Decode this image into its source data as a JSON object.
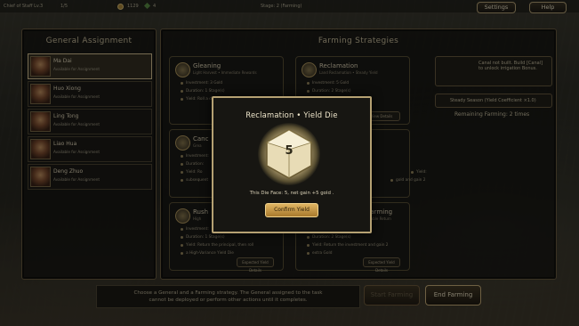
{
  "topbar": {
    "player_label": "Chief of Staff Lv.3",
    "player_extra": "1/5",
    "gold": "1129",
    "gems": "4",
    "stage": "Stage: 2 (Farming)",
    "settings_label": "Settings",
    "help_label": "Help"
  },
  "generals_panel": {
    "title": "General Assignment",
    "items": [
      {
        "name": "Ma Dai",
        "status": "Available for Assignment"
      },
      {
        "name": "Huo Xiong",
        "status": "Available for Assignment"
      },
      {
        "name": "Ling Tong",
        "status": "Available for Assignment"
      },
      {
        "name": "Liao Hua",
        "status": "Available for Assignment"
      },
      {
        "name": "Deng Zhuo",
        "status": "Available for Assignment"
      }
    ]
  },
  "strategies_panel": {
    "title": "Farming Strategies",
    "cards": [
      {
        "title": "Gleaning",
        "subtitle": "Light Harvest • Immediate Rewards",
        "lines": [
          "Investment: 3 Gold",
          "Duration: 1 Stage(s)",
          "Yield: Roll a d4 Yield Die"
        ],
        "button": "View Details"
      },
      {
        "title": "Reclamation",
        "subtitle": "Land Reclamation • Steady Yield",
        "lines": [
          "Investment: 5 Gold",
          "Duration: 2 Stage(s)",
          "Yield: Roll a High-Yield Die"
        ],
        "button": "View Details"
      },
      {
        "title": "Canc",
        "subtitle": "Grea",
        "lines": [
          "Investment:",
          "Duration:",
          "Yield: Ro",
          "subsequent"
        ],
        "button": ""
      },
      {
        "title": "",
        "subtitle": "",
        "lines": [
          "",
          "",
          "Yield: ",
          "gold and gain 2"
        ],
        "button": ""
      },
      {
        "title": "Rush",
        "subtitle": "High",
        "lines": [
          "Investment:",
          "Duration: 1 Stage(s)",
          "Yield: Return the principal, then roll",
          "a High-Variance Yield Die"
        ],
        "button": "Expected Yield Details"
      },
      {
        "title": "Farming",
        "subtitle": "• Stable Return",
        "lines": [
          "Investment:",
          "Duration: 2 Stage(s)",
          "Yield: Return the investment and gain 2",
          "extra Gold"
        ],
        "button": "Expected Yield Details"
      }
    ]
  },
  "side_panel": {
    "canal_note": "Canal not built. Build [Canal] to unlock irrigation Bonus.",
    "season": "Steady Season (Yield Coefficient ×1.0)",
    "remaining": "Remaining Farming: 2 times"
  },
  "footer": {
    "hint_line1": "Choose a General and a Farming strategy. The General assigned to the task",
    "hint_line2": "cannot be deployed or perform other actions until it completes.",
    "start_label": "Start Farming",
    "end_label": "End Farming"
  },
  "modal": {
    "title": "Reclamation  •  Yield Die",
    "die_value": "5",
    "result_text": "This Die Face: 5, net gain +5 gold .",
    "confirm_label": "Confirm Yield"
  }
}
